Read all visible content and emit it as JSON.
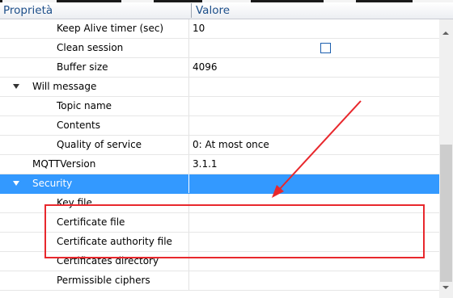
{
  "header": {
    "property_label": "Proprietà",
    "value_label": "Valore"
  },
  "rows": [
    {
      "label": "Keep Alive timer (sec)",
      "value": "10"
    },
    {
      "label": "Clean session",
      "value": ""
    },
    {
      "label": "Buffer size",
      "value": "4096"
    },
    {
      "label": "Will message",
      "value": ""
    },
    {
      "label": "Topic name",
      "value": ""
    },
    {
      "label": "Contents",
      "value": ""
    },
    {
      "label": "Quality of service",
      "value": "0: At most once"
    },
    {
      "label": "MQTTVersion",
      "value": "3.1.1"
    },
    {
      "label": "Security",
      "value": ""
    },
    {
      "label": "Key file",
      "value": ""
    },
    {
      "label": "Certificate file",
      "value": ""
    },
    {
      "label": "Certificate authority file",
      "value": ""
    },
    {
      "label": "Certificates directory",
      "value": ""
    },
    {
      "label": "Permissible ciphers",
      "value": ""
    }
  ],
  "clean_session_checked": false,
  "expanded_groups": [
    "Will message",
    "Security"
  ],
  "selected_row": "Security",
  "colors": {
    "selection": "#3399ff",
    "header_text": "#1d4f8a",
    "annotation": "#e8282d",
    "checkbox_border": "#1c5fae"
  },
  "icons": {
    "expander": "expanded-triangle-icon",
    "scroll_up": "scroll-up-arrow-icon",
    "scroll_down": "scroll-down-arrow-icon"
  }
}
